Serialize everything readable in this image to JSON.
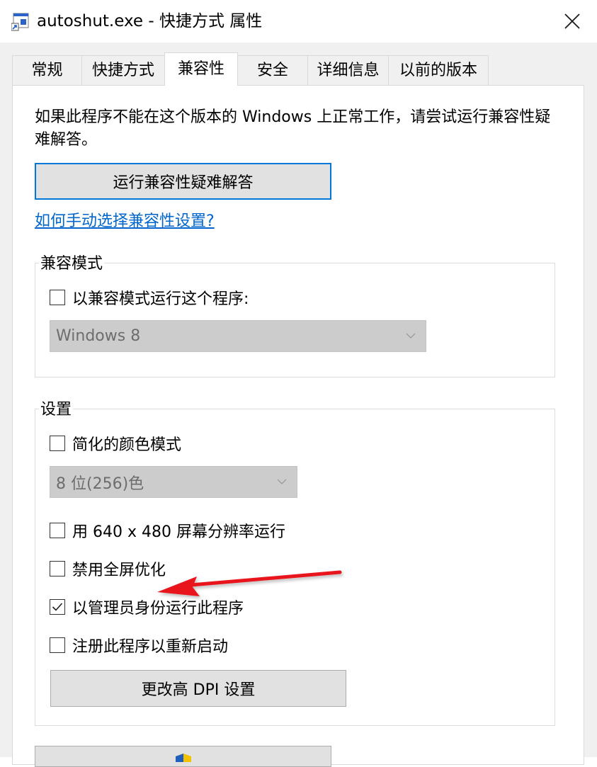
{
  "window": {
    "title": "autoshut.exe - 快捷方式 属性"
  },
  "tabs": [
    {
      "label": "常规"
    },
    {
      "label": "快捷方式"
    },
    {
      "label": "兼容性"
    },
    {
      "label": "安全"
    },
    {
      "label": "详细信息"
    },
    {
      "label": "以前的版本"
    }
  ],
  "active_tab": "兼容性",
  "compat": {
    "intro": "如果此程序不能在这个版本的 Windows 上正常工作，请尝试运行兼容性疑难解答。",
    "troubleshoot_button": "运行兼容性疑难解答",
    "manual_link": "如何手动选择兼容性设置?"
  },
  "compat_mode": {
    "group_label": "兼容模式",
    "checkbox_label": "以兼容模式运行这个程序:",
    "checked": false,
    "os_select_value": "Windows 8"
  },
  "settings": {
    "group_label": "设置",
    "reduced_color": {
      "label": "简化的颜色模式",
      "checked": false
    },
    "color_select_value": "8 位(256)色",
    "res_640": {
      "label": "用 640 x 480 屏幕分辨率运行",
      "checked": false
    },
    "disable_fullscreen": {
      "label": "禁用全屏优化",
      "checked": false
    },
    "run_as_admin": {
      "label": "以管理员身份运行此程序",
      "checked": true
    },
    "register_restart": {
      "label": "注册此程序以重新启动",
      "checked": false
    },
    "dpi_button": "更改高 DPI 设置"
  },
  "colors": {
    "accent": "#0078d7",
    "link": "#0066cc",
    "annotation_arrow": "#e8161b"
  },
  "icons": [
    "shortcut-app-icon",
    "close-icon",
    "checkmark-icon",
    "chevron-down-icon",
    "shield-icon"
  ]
}
